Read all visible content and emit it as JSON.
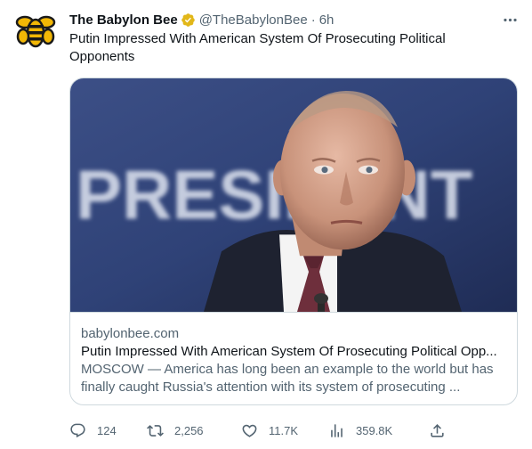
{
  "tweet": {
    "display_name": "The Babylon Bee",
    "handle": "@TheBabylonBee",
    "separator": "·",
    "time": "6h",
    "text": "Putin Impressed With American System Of Prosecuting Political Opponents"
  },
  "card": {
    "domain": "babylonbee.com",
    "title": "Putin Impressed With American System Of Prosecuting Political Opp...",
    "description": "MOSCOW — America has long been an example to the world but has finally caught Russia's attention with its system of prosecuting ...",
    "image_background_text": "PRESIDENT"
  },
  "actions": {
    "replies": "124",
    "retweets": "2,256",
    "likes": "11.7K",
    "views": "359.8K"
  },
  "icons": {
    "avatar": "babylon-bee-logo-icon",
    "verified": "verified-badge-icon",
    "more": "more-icon",
    "reply": "reply-icon",
    "retweet": "retweet-icon",
    "like": "heart-icon",
    "views": "views-icon",
    "share": "share-icon"
  },
  "colors": {
    "text": "#0f1419",
    "secondary": "#536471",
    "border": "#cfd9de",
    "verified": "#e2b719"
  }
}
